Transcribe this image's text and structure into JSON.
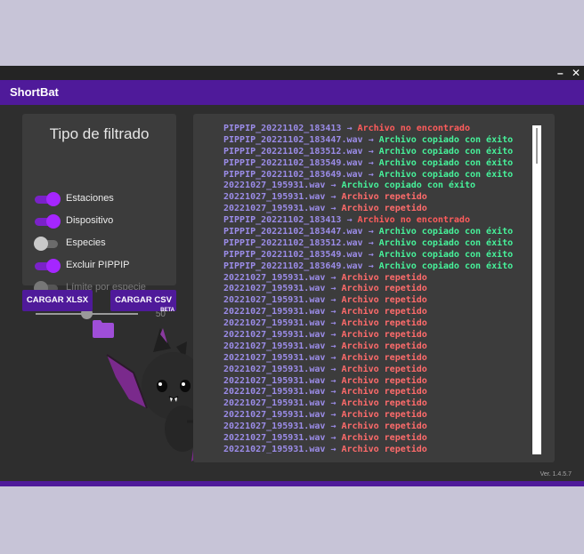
{
  "window": {
    "minimize_symbol": "–",
    "close_symbol": "✕"
  },
  "app": {
    "title": "ShortBat"
  },
  "filter": {
    "title": "Tipo de filtrado",
    "switches": [
      {
        "label": "Estaciones",
        "state": "on"
      },
      {
        "label": "Dispositivo",
        "state": "on"
      },
      {
        "label": "Especies",
        "state": "off"
      },
      {
        "label": "Excluir PIPPIP",
        "state": "on"
      },
      {
        "label": "Límite por especie",
        "state": "disabled"
      }
    ],
    "slider": {
      "value": "50",
      "fraction": 0.5
    }
  },
  "buttons": {
    "xlsx": "CARGAR XLSX",
    "csv": "CARGAR CSV",
    "beta": "BETA"
  },
  "log": {
    "arrow": "→",
    "lines": [
      {
        "file": "PIPPIP_20221102_183413",
        "status": "Archivo no encontrado",
        "type": "err"
      },
      {
        "file": "PIPPIP_20221102_183447.wav",
        "status": "Archivo copiado con éxito",
        "type": "ok"
      },
      {
        "file": "PIPPIP_20221102_183512.wav",
        "status": "Archivo copiado con éxito",
        "type": "ok"
      },
      {
        "file": "PIPPIP_20221102_183549.wav",
        "status": "Archivo copiado con éxito",
        "type": "ok"
      },
      {
        "file": "PIPPIP_20221102_183649.wav",
        "status": "Archivo copiado con éxito",
        "type": "ok"
      },
      {
        "file": "20221027_195931.wav",
        "status": "Archivo copiado con éxito",
        "type": "ok"
      },
      {
        "file": "20221027_195931.wav",
        "status": "Archivo repetido",
        "type": "rep"
      },
      {
        "file": "20221027_195931.wav",
        "status": "Archivo repetido",
        "type": "rep"
      },
      {
        "file": "PIPPIP_20221102_183413",
        "status": "Archivo no encontrado",
        "type": "err"
      },
      {
        "file": "PIPPIP_20221102_183447.wav",
        "status": "Archivo copiado con éxito",
        "type": "ok"
      },
      {
        "file": "PIPPIP_20221102_183512.wav",
        "status": "Archivo copiado con éxito",
        "type": "ok"
      },
      {
        "file": "PIPPIP_20221102_183549.wav",
        "status": "Archivo copiado con éxito",
        "type": "ok"
      },
      {
        "file": "PIPPIP_20221102_183649.wav",
        "status": "Archivo copiado con éxito",
        "type": "ok"
      },
      {
        "file": "20221027_195931.wav",
        "status": "Archivo repetido",
        "type": "rep"
      },
      {
        "file": "20221027_195931.wav",
        "status": "Archivo repetido",
        "type": "rep"
      },
      {
        "file": "20221027_195931.wav",
        "status": "Archivo repetido",
        "type": "rep"
      },
      {
        "file": "20221027_195931.wav",
        "status": "Archivo repetido",
        "type": "rep"
      },
      {
        "file": "20221027_195931.wav",
        "status": "Archivo repetido",
        "type": "rep"
      },
      {
        "file": "20221027_195931.wav",
        "status": "Archivo repetido",
        "type": "rep"
      },
      {
        "file": "20221027_195931.wav",
        "status": "Archivo repetido",
        "type": "rep"
      },
      {
        "file": "20221027_195931.wav",
        "status": "Archivo repetido",
        "type": "rep"
      },
      {
        "file": "20221027_195931.wav",
        "status": "Archivo repetido",
        "type": "rep"
      },
      {
        "file": "20221027_195931.wav",
        "status": "Archivo repetido",
        "type": "rep"
      },
      {
        "file": "20221027_195931.wav",
        "status": "Archivo repetido",
        "type": "rep"
      },
      {
        "file": "20221027_195931.wav",
        "status": "Archivo repetido",
        "type": "rep"
      },
      {
        "file": "20221027_195931.wav",
        "status": "Archivo repetido",
        "type": "rep"
      },
      {
        "file": "20221027_195931.wav",
        "status": "Archivo repetido",
        "type": "rep"
      },
      {
        "file": "20221027_195931.wav",
        "status": "Archivo repetido",
        "type": "rep"
      },
      {
        "file": "20221027_195931.wav",
        "status": "Archivo repetido",
        "type": "rep"
      }
    ],
    "scroll_fraction": 0.0
  },
  "version": "Ver. 1.4.5.7",
  "colors": {
    "accent": "#4f1a9a",
    "switch_on": "#a526ff",
    "ok": "#46f29a",
    "error": "#ff5c5c",
    "filename": "#9b8ce8"
  },
  "icons": [
    "folder-icon",
    "bat-mascot"
  ]
}
